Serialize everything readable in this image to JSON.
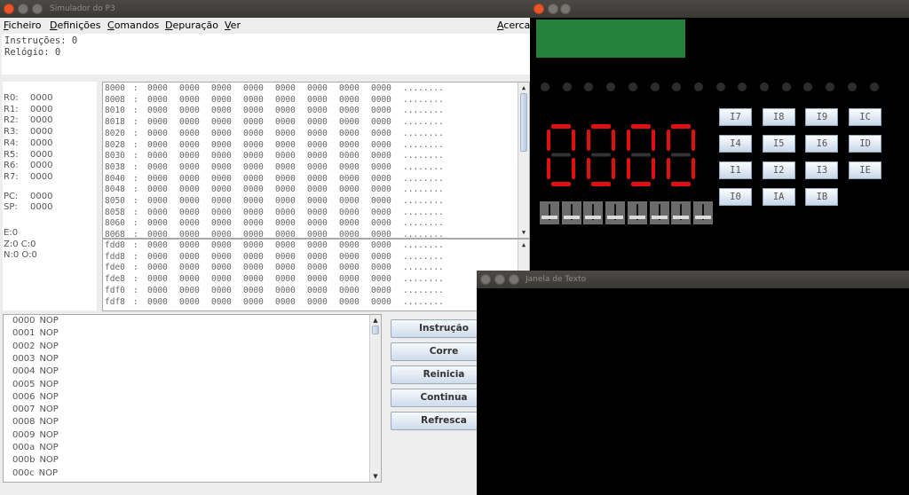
{
  "main_window": {
    "title": "Simulador do P3",
    "menu": [
      "Ficheiro",
      "Definições",
      "Comandos",
      "Depuração",
      "Ver"
    ],
    "menu_right": "Acerca",
    "instructions_label": "Instruções: 0",
    "clock_label": "Relógio: 0",
    "registers": [
      {
        "name": "R0:",
        "value": "0000"
      },
      {
        "name": "R1:",
        "value": "0000"
      },
      {
        "name": "R2:",
        "value": "0000"
      },
      {
        "name": "R3:",
        "value": "0000"
      },
      {
        "name": "R4:",
        "value": "0000"
      },
      {
        "name": "R5:",
        "value": "0000"
      },
      {
        "name": "R6:",
        "value": "0000"
      },
      {
        "name": "R7:",
        "value": "0000"
      },
      {
        "name": "PC:",
        "value": "0000"
      },
      {
        "name": "SP:",
        "value": "0000"
      }
    ],
    "flags": [
      "E:0",
      "Z:0 C:0",
      "N:0 O:0"
    ],
    "memory_top": [
      "8000",
      "8008",
      "8010",
      "8018",
      "8020",
      "8028",
      "8030",
      "8038",
      "8040",
      "8048",
      "8050",
      "8058",
      "8060",
      "8068"
    ],
    "memory_bottom": [
      "fdd0",
      "fdd8",
      "fde0",
      "fde8",
      "fdf0",
      "fdf8"
    ],
    "memory_value": "0000",
    "memory_ascii": "........",
    "program": [
      "0000",
      "0001",
      "0002",
      "0003",
      "0004",
      "0005",
      "0006",
      "0007",
      "0008",
      "0009",
      "000a",
      "000b",
      "000c"
    ],
    "program_op": "NOP",
    "buttons": [
      "Instrução",
      "Corre",
      "Reinicia",
      "Continua",
      "Refresca"
    ]
  },
  "board_window": {
    "lcd_color": "#25803a",
    "leds_on": [
      false,
      false,
      false,
      false,
      false,
      false,
      false,
      false,
      false,
      false,
      false,
      false,
      false,
      false,
      false,
      false
    ],
    "display": "0000",
    "display_color": "#e01010",
    "interrupt_buttons": [
      [
        "I7",
        "I8",
        "I9",
        "IC"
      ],
      [
        "I4",
        "I5",
        "I6",
        "ID"
      ],
      [
        "I1",
        "I2",
        "I3",
        "IE"
      ],
      [
        "I0",
        "IA",
        "IB"
      ]
    ],
    "switches": [
      0,
      0,
      0,
      0,
      0,
      0,
      0,
      0
    ]
  },
  "text_window": {
    "title": "Janela de Texto"
  }
}
